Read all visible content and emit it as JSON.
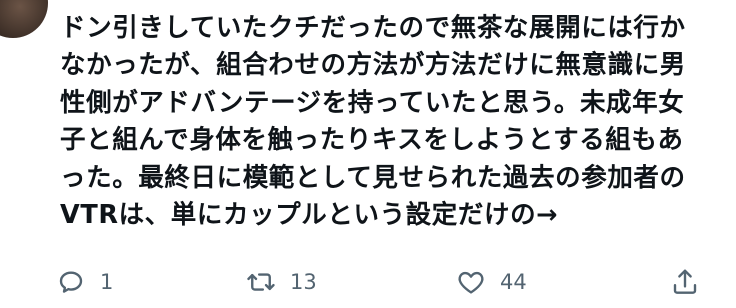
{
  "tweet": {
    "author_name": "",
    "author_handle": "",
    "body_lines": [
      "ドン引きしていたクチだったので無茶な展開には行か",
      "なかったが、組合わせの方法が方法だけに無意識に男",
      "性側がアドバンテージを持っていたと思う。未成年女",
      "子と組んで身体を触ったりキスをしようとする組もあ",
      "った。最終日に模範として見せられた過去の参加者の",
      "VTRは、単にカップルという設定だけの→"
    ]
  },
  "actions": {
    "reply_count": "1",
    "retweet_count": "13",
    "like_count": "44",
    "share_icon": "share-icon"
  },
  "colors": {
    "text": "#0f1419",
    "secondary": "#536471"
  }
}
